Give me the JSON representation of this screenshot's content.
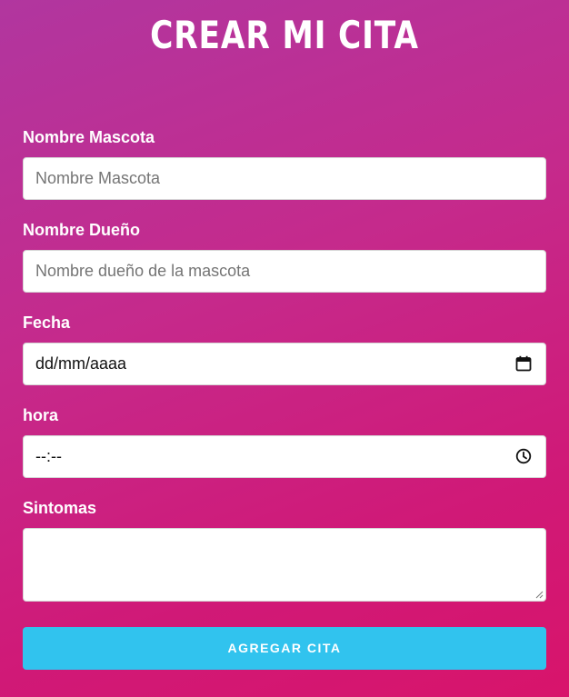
{
  "header": {
    "title": "CREAR MI CITA"
  },
  "form": {
    "pet_name": {
      "label": "Nombre Mascota",
      "placeholder": "Nombre Mascota"
    },
    "owner_name": {
      "label": "Nombre Dueño",
      "placeholder": "Nombre dueño de la mascota"
    },
    "date": {
      "label": "Fecha",
      "value": "dd/mm/aaaa",
      "icon": "calendar-icon"
    },
    "time": {
      "label": "hora",
      "value": "--:--",
      "icon": "clock-icon"
    },
    "symptoms": {
      "label": "Sintomas",
      "value": ""
    },
    "submit_label": "AGREGAR CITA"
  },
  "colors": {
    "background_start": "#b1369f",
    "background_end": "#d8146b",
    "button": "#31c3ee",
    "text": "#ffffff"
  }
}
